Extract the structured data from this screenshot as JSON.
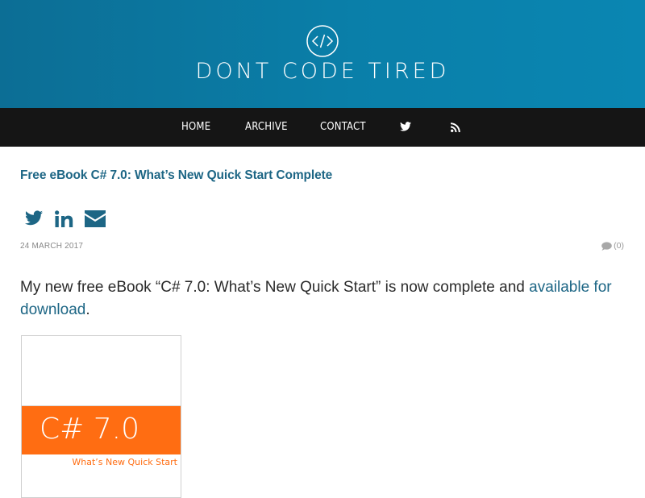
{
  "site": {
    "title": "DONT CODE TIRED",
    "logo_icon": "code-icon"
  },
  "nav": {
    "items": [
      {
        "label": "HOME"
      },
      {
        "label": "ARCHIVE"
      },
      {
        "label": "CONTACT"
      }
    ],
    "twitter_icon": "twitter-icon",
    "rss_icon": "rss-icon"
  },
  "post": {
    "title": "Free eBook C# 7.0: What’s New Quick Start Complete",
    "share_icons": [
      "twitter-icon",
      "linkedin-icon",
      "email-icon"
    ],
    "date": "24 MARCH 2017",
    "comments_count": "(0)",
    "body_text": "My new free eBook “C# 7.0: What’s New Quick Start” is now complete and ",
    "link_text": "available for download",
    "body_end": "."
  },
  "book_cover": {
    "title": "C# 7.0",
    "subtitle": "What’s New Quick Start"
  },
  "colors": {
    "header_bg": "#0a7fa9",
    "nav_bg": "#151515",
    "link": "#1d6685",
    "book_band": "#ff6d12"
  }
}
